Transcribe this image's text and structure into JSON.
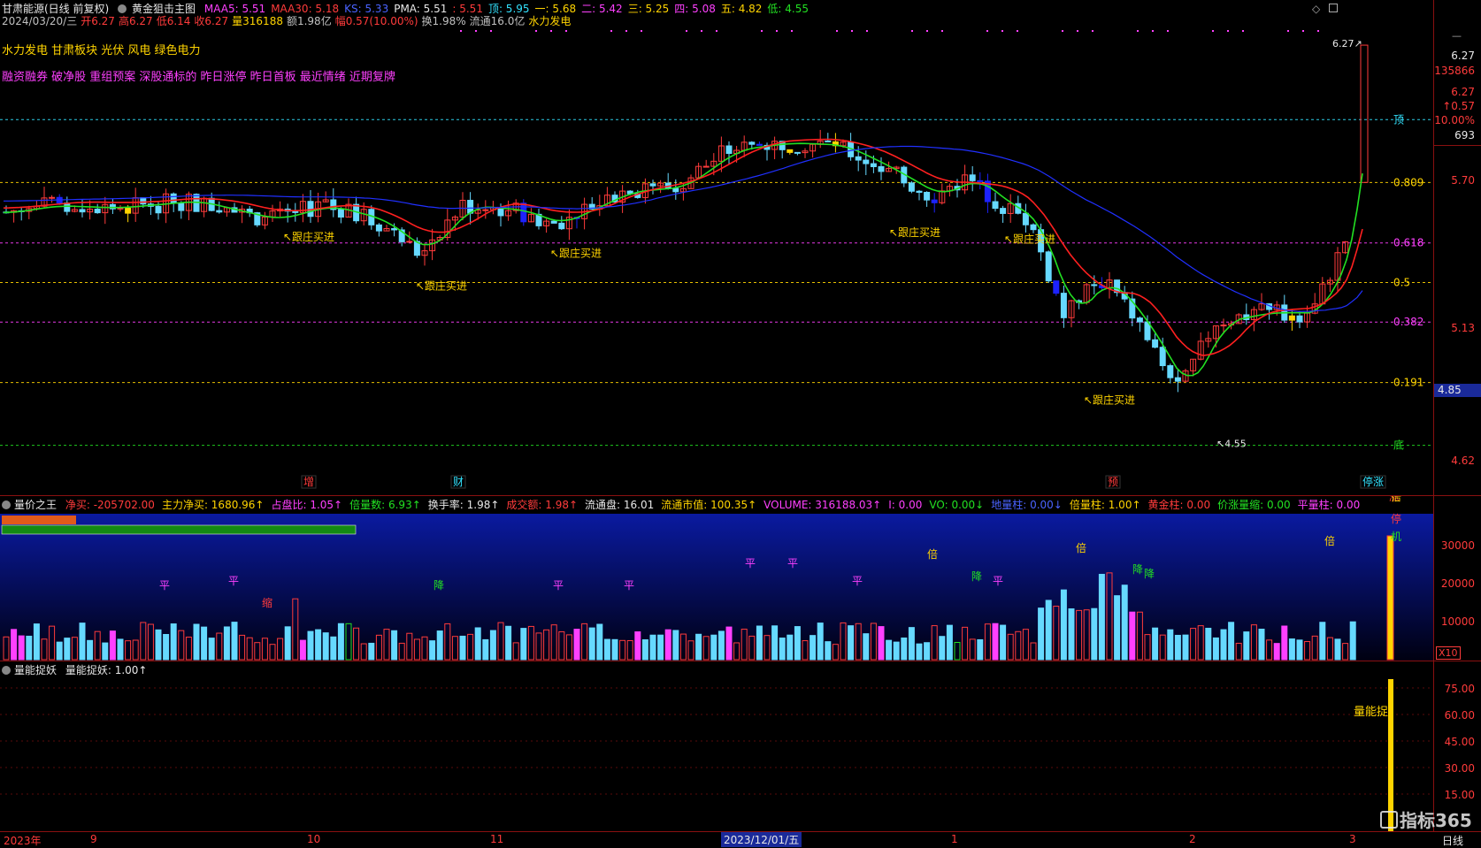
{
  "header": {
    "stock_title": "甘肃能源(日线 前复权)",
    "indicator_name": "黄金狙击主图",
    "ma": [
      {
        "label": "MAA5: 5.51",
        "color": "#ff40ff"
      },
      {
        "label": "MAA30: 5.18",
        "color": "#ff3b3b"
      },
      {
        "label": "KS: 5.33",
        "color": "#4a63ff"
      },
      {
        "label": "PMA: 5.51",
        "color": "#e8e8e8"
      },
      {
        "label": ": 5.51",
        "color": "#ff3b3b"
      },
      {
        "label": "顶: 5.95",
        "color": "#33e3ff"
      },
      {
        "label": "一: 5.68",
        "color": "#ffd400"
      },
      {
        "label": "二: 5.42",
        "color": "#ff40ff"
      },
      {
        "label": "三: 5.25",
        "color": "#ffd400"
      },
      {
        "label": "四: 5.08",
        "color": "#ff40ff"
      },
      {
        "label": "五: 4.82",
        "color": "#ffd400"
      },
      {
        "label": "低: 4.55",
        "color": "#22e022"
      }
    ],
    "quote": [
      {
        "label": "2024/03/20/三",
        "color": "#c0c0c0"
      },
      {
        "label": "开6.27",
        "color": "#ff3b3b"
      },
      {
        "label": "高6.27",
        "color": "#ff3b3b"
      },
      {
        "label": "低6.14",
        "color": "#ff3b3b"
      },
      {
        "label": "收6.27",
        "color": "#ff3b3b"
      },
      {
        "label": "量316188",
        "color": "#ffd400"
      },
      {
        "label": "额1.98亿",
        "color": "#c0c0c0"
      },
      {
        "label": "幅0.57(10.00%)",
        "color": "#ff3b3b"
      },
      {
        "label": "换1.98%",
        "color": "#c0c0c0"
      },
      {
        "label": "流通16.0亿",
        "color": "#c0c0c0"
      },
      {
        "label": "水力发电",
        "color": "#ffd400"
      }
    ],
    "concepts_line1": "水力发电 甘肃板块 光伏 风电 绿色电力",
    "concepts_line2": "融资融券 破净股 重组预案 深股通标的 昨日涨停 昨日首板 最近情绪 近期复牌"
  },
  "main_chart": {
    "y_axis": {
      "min": 4.45,
      "max": 6.35
    },
    "levels": [
      {
        "label": "顶",
        "value": 5.95,
        "color": "#33e3ff"
      },
      {
        "label": "0.809",
        "value": 5.68,
        "color": "#ffd400"
      },
      {
        "label": "0.618",
        "value": 5.42,
        "color": "#ff40ff"
      },
      {
        "label": "0.5",
        "value": 5.25,
        "color": "#ffd400"
      },
      {
        "label": "0.382",
        "value": 5.08,
        "color": "#ff40ff"
      },
      {
        "label": "0.191",
        "value": 4.82,
        "color": "#ffd400"
      },
      {
        "label": "底",
        "value": 4.55,
        "color": "#22e022"
      }
    ],
    "annotations": [
      "↖跟庄买进",
      "↖跟庄买进",
      "↖跟庄买进",
      "↖跟庄买进",
      "↖跟庄买进",
      "↖跟庄买进"
    ],
    "low_marker": "4.55",
    "high_marker": "6.27",
    "event_labels": [
      "增",
      "财",
      "预",
      "停涨"
    ],
    "right_axis": {
      "price_top": "6.27",
      "volume": "135866",
      "price2": "6.27",
      "change": "↑0.57",
      "pct": "10.00%",
      "count": "693",
      "tick_570": "5.70",
      "tick_513": "5.13",
      "tick_485": "4.85",
      "tick_462": "4.62"
    }
  },
  "volume_panel": {
    "title": "量价之王",
    "stats": [
      {
        "label": "净买: -205702.00",
        "color": "#ff3b3b"
      },
      {
        "label": "主力净买: 1680.96↑",
        "color": "#ffd400"
      },
      {
        "label": "占盘比: 1.05↑",
        "color": "#ff40ff"
      },
      {
        "label": "倍量数: 6.93↑",
        "color": "#22e022"
      },
      {
        "label": "换手率: 1.98↑",
        "color": "#e8e8e8"
      },
      {
        "label": "成交额: 1.98↑",
        "color": "#ff3b3b"
      },
      {
        "label": "流通盘: 16.01",
        "color": "#e8e8e8"
      },
      {
        "label": "流通市值: 100.35↑",
        "color": "#ffd400"
      },
      {
        "label": "VOLUME: 316188.03↑",
        "color": "#ff40ff"
      },
      {
        "label": "I: 0.00",
        "color": "#ff40ff"
      },
      {
        "label": "VO: 0.00↓",
        "color": "#22e022"
      },
      {
        "label": "地量柱: 0.00↓",
        "color": "#4a63ff"
      },
      {
        "label": "倍量柱: 1.00↑",
        "color": "#ffd400"
      },
      {
        "label": "黄金柱: 0.00",
        "color": "#ff3b3b"
      },
      {
        "label": "价涨量缩: 0.00",
        "color": "#22e022"
      },
      {
        "label": "平量柱: 0.00",
        "color": "#ff40ff"
      }
    ],
    "y_ticks": [
      "30000",
      "20000",
      "10000"
    ],
    "multiplier": "X10",
    "bar_labels": [
      "平",
      "平",
      "缩",
      "降",
      "平",
      "平",
      "平",
      "平",
      "平",
      "倍",
      "降",
      "平",
      "倍",
      "降",
      "降",
      "倍",
      "涨",
      "停",
      "倍",
      "机"
    ]
  },
  "energy_panel": {
    "title": "量能捉妖",
    "value_label": "量能捉妖: 1.00↑",
    "y_ticks": [
      "75.00",
      "60.00",
      "45.00",
      "30.00",
      "15.00"
    ],
    "side_label": "量能捉"
  },
  "date_axis": {
    "labels": [
      "2023年",
      "9",
      "10",
      "11",
      "2023/12/01/五",
      "1",
      "2",
      "3"
    ],
    "period": "日线"
  },
  "watermark": "指标365",
  "chart_data": {
    "type": "candlestick",
    "title": "甘肃能源(日线 前复权)",
    "dates_start": "2023年",
    "last_date": "2024/03/20",
    "last_bar": {
      "open": 6.27,
      "high": 6.27,
      "low": 6.14,
      "close": 6.27,
      "volume": 316188
    },
    "period_high": 6.27,
    "period_low": 4.55,
    "ylim": [
      4.45,
      6.35
    ]
  }
}
